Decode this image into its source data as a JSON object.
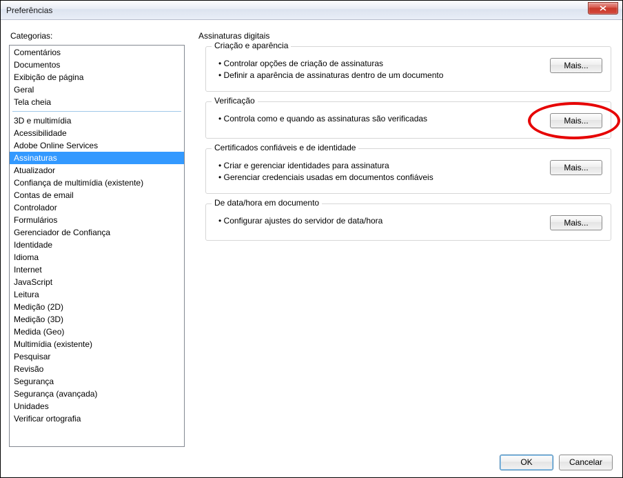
{
  "window": {
    "title": "Preferências"
  },
  "sidebar": {
    "label": "Categorias:",
    "group_top": [
      "Comentários",
      "Documentos",
      "Exibição de página",
      "Geral",
      "Tela cheia"
    ],
    "group_main": [
      "3D e multimídia",
      "Acessibilidade",
      "Adobe Online Services",
      "Assinaturas",
      "Atualizador",
      "Confiança de multimídia (existente)",
      "Contas de email",
      "Controlador",
      "Formulários",
      "Gerenciador de Confiança",
      "Identidade",
      "Idioma",
      "Internet",
      "JavaScript",
      "Leitura",
      "Medição (2D)",
      "Medição (3D)",
      "Medida (Geo)",
      "Multimídia (existente)",
      "Pesquisar",
      "Revisão",
      "Segurança",
      "Segurança (avançada)",
      "Unidades",
      "Verificar ortografia"
    ],
    "selected": "Assinaturas"
  },
  "panel": {
    "title": "Assinaturas digitais",
    "groups": [
      {
        "legend": "Criação e aparência",
        "bullets": [
          "Controlar opções de criação de assinaturas",
          "Definir a aparência de assinaturas dentro de um documento"
        ],
        "button": "Mais..."
      },
      {
        "legend": "Verificação",
        "bullets": [
          "Controla como e quando as assinaturas são verificadas"
        ],
        "button": "Mais..."
      },
      {
        "legend": "Certificados confiáveis e de identidade",
        "bullets": [
          "Criar e gerenciar identidades para assinatura",
          "Gerenciar credenciais usadas em documentos confiáveis"
        ],
        "button": "Mais..."
      },
      {
        "legend": "De data/hora em documento",
        "bullets": [
          "Configurar ajustes do servidor de data/hora"
        ],
        "button": "Mais..."
      }
    ]
  },
  "footer": {
    "ok": "OK",
    "cancel": "Cancelar"
  },
  "annotation": {
    "highlight_group_index": 1
  }
}
